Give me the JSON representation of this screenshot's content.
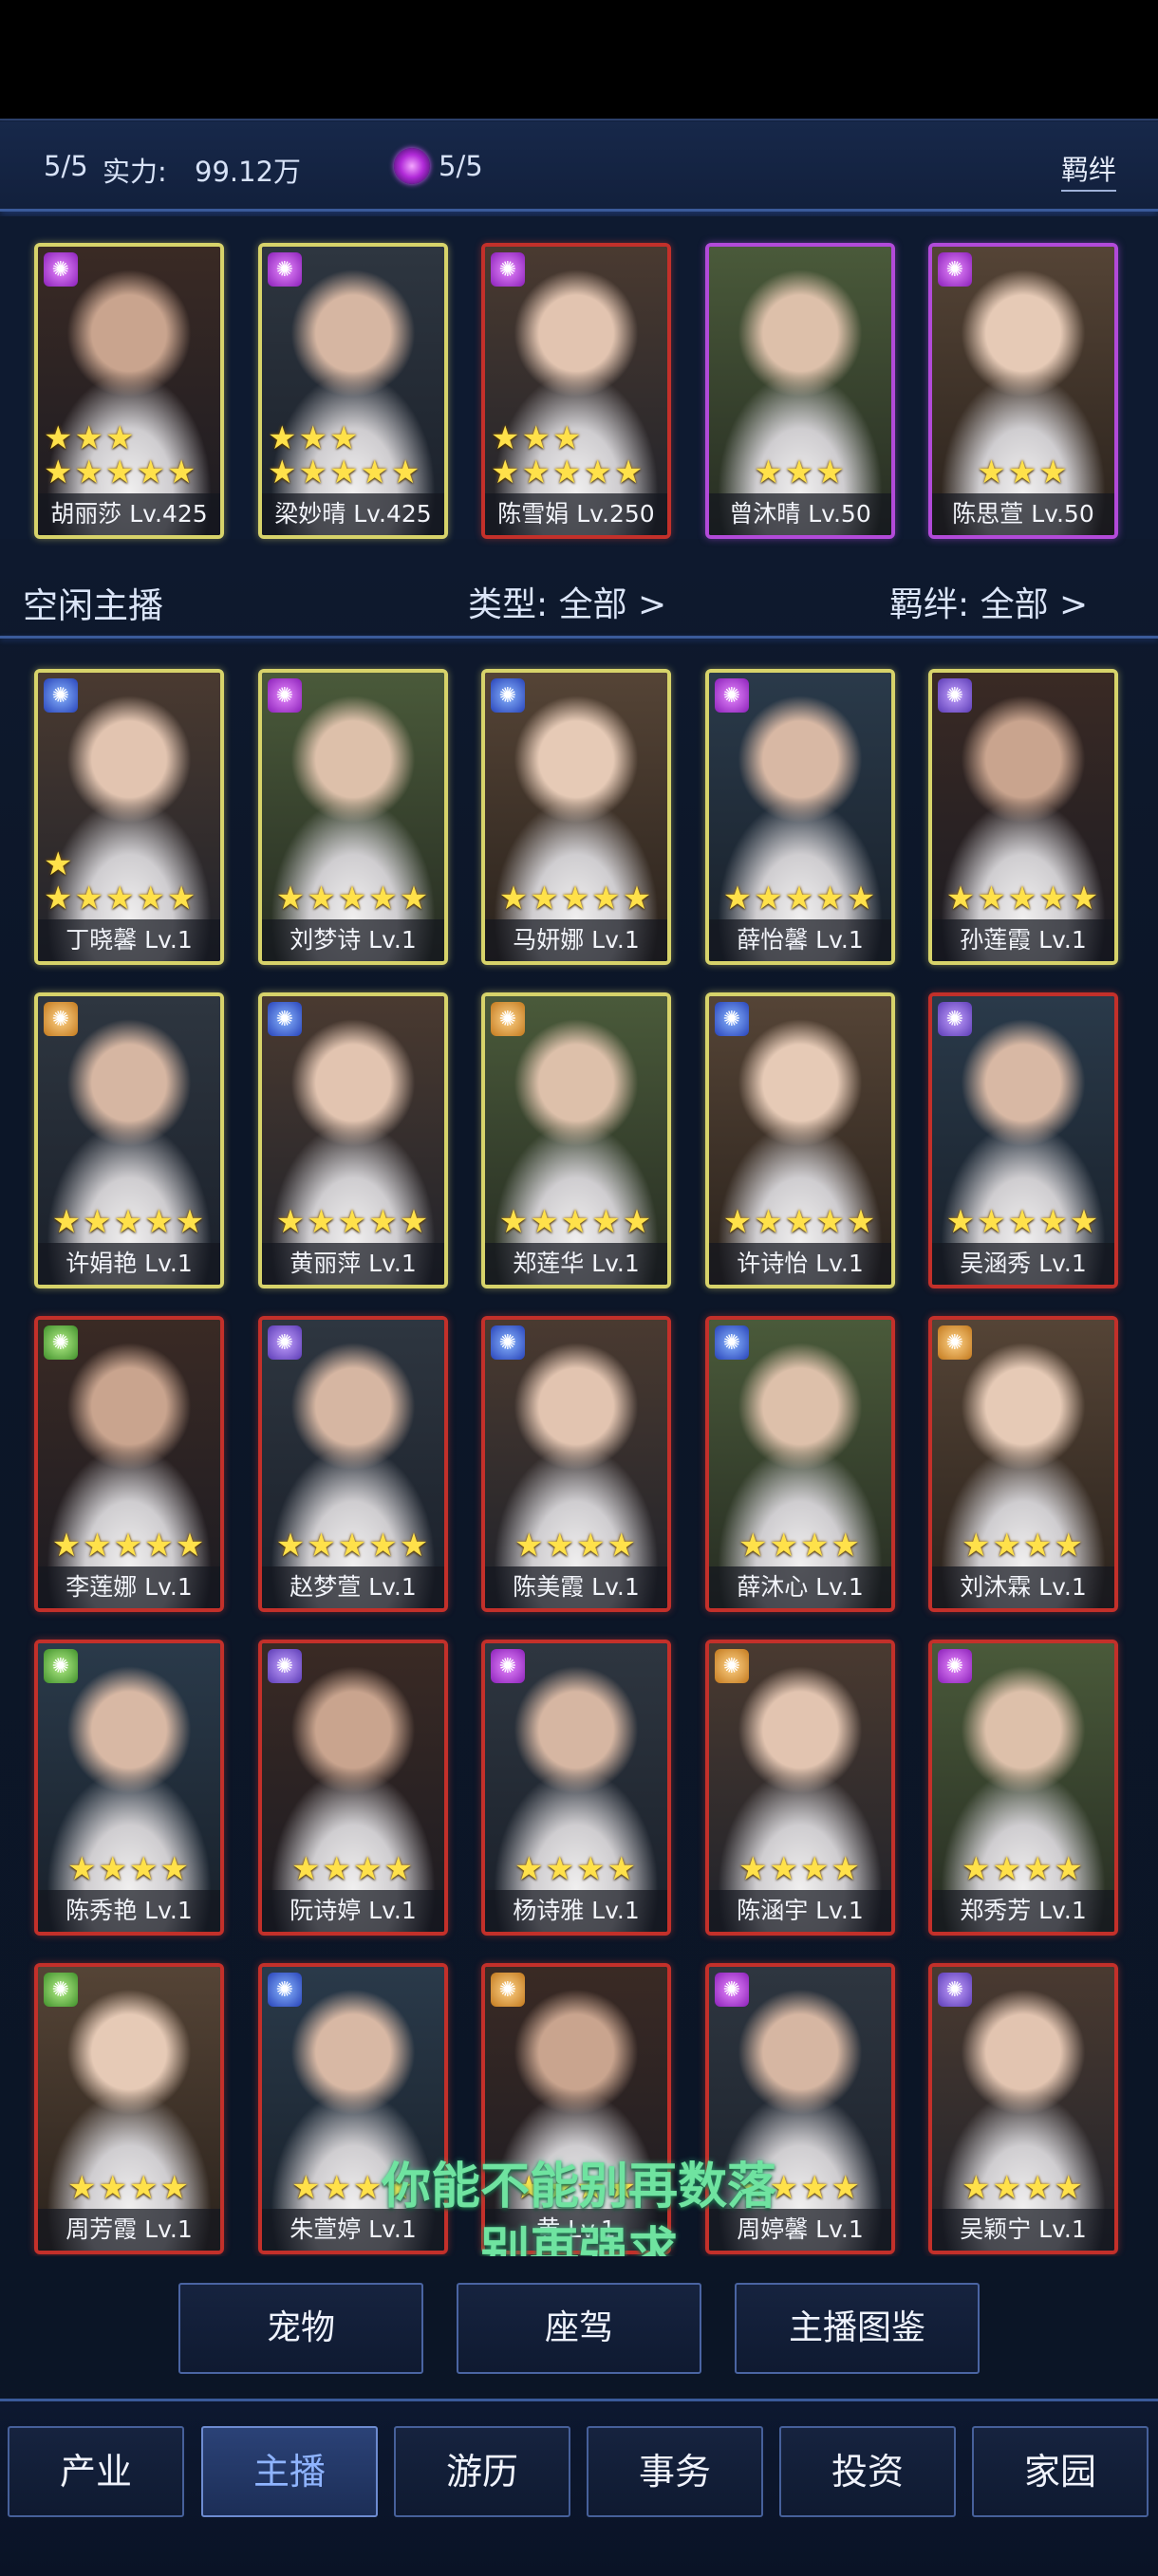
{
  "header": {
    "count": "5/5",
    "power_label": "实力:",
    "power_value": "99.12万",
    "gem_count": "5/5",
    "bond_button": "羁绊"
  },
  "team": [
    {
      "name": "胡丽莎",
      "level": "Lv.425",
      "stars": 8,
      "frame": "gold",
      "badge": "purple"
    },
    {
      "name": "梁妙晴",
      "level": "Lv.425",
      "stars": 8,
      "frame": "gold",
      "badge": "purple"
    },
    {
      "name": "陈雪娟",
      "level": "Lv.250",
      "stars": 8,
      "frame": "red",
      "badge": "purple"
    },
    {
      "name": "曾沐晴",
      "level": "Lv.50",
      "stars": 3,
      "frame": "purple",
      "badge": "none"
    },
    {
      "name": "陈思萱",
      "level": "Lv.50",
      "stars": 3,
      "frame": "purple",
      "badge": "purple"
    }
  ],
  "idle": {
    "title": "空闲主播",
    "type_filter": "类型: 全部 >",
    "bond_filter": "羁绊: 全部 >"
  },
  "hosts": [
    {
      "name": "丁晓馨",
      "level": "Lv.1",
      "stars": 6,
      "frame": "gold",
      "badge": "blue"
    },
    {
      "name": "刘梦诗",
      "level": "Lv.1",
      "stars": 5,
      "frame": "gold",
      "badge": "purple"
    },
    {
      "name": "马妍娜",
      "level": "Lv.1",
      "stars": 5,
      "frame": "gold",
      "badge": "blue"
    },
    {
      "name": "薛怡馨",
      "level": "Lv.1",
      "stars": 5,
      "frame": "gold",
      "badge": "purple"
    },
    {
      "name": "孙莲霞",
      "level": "Lv.1",
      "stars": 5,
      "frame": "gold",
      "badge": "violet"
    },
    {
      "name": "许娟艳",
      "level": "Lv.1",
      "stars": 5,
      "frame": "gold",
      "badge": "orange"
    },
    {
      "name": "黄丽萍",
      "level": "Lv.1",
      "stars": 5,
      "frame": "gold",
      "badge": "blue"
    },
    {
      "name": "郑莲华",
      "level": "Lv.1",
      "stars": 5,
      "frame": "gold",
      "badge": "orange"
    },
    {
      "name": "许诗怡",
      "level": "Lv.1",
      "stars": 5,
      "frame": "gold",
      "badge": "blue"
    },
    {
      "name": "吴涵秀",
      "level": "Lv.1",
      "stars": 5,
      "frame": "red",
      "badge": "violet"
    },
    {
      "name": "李莲娜",
      "level": "Lv.1",
      "stars": 5,
      "frame": "red",
      "badge": "green"
    },
    {
      "name": "赵梦萱",
      "level": "Lv.1",
      "stars": 5,
      "frame": "red",
      "badge": "violet"
    },
    {
      "name": "陈美霞",
      "level": "Lv.1",
      "stars": 4,
      "frame": "red",
      "badge": "blue"
    },
    {
      "name": "薛沐心",
      "level": "Lv.1",
      "stars": 4,
      "frame": "red",
      "badge": "blue"
    },
    {
      "name": "刘沐霖",
      "level": "Lv.1",
      "stars": 4,
      "frame": "red",
      "badge": "orange"
    },
    {
      "name": "陈秀艳",
      "level": "Lv.1",
      "stars": 4,
      "frame": "red",
      "badge": "green"
    },
    {
      "name": "阮诗婷",
      "level": "Lv.1",
      "stars": 4,
      "frame": "red",
      "badge": "violet"
    },
    {
      "name": "杨诗雅",
      "level": "Lv.1",
      "stars": 4,
      "frame": "red",
      "badge": "purple"
    },
    {
      "name": "陈涵宇",
      "level": "Lv.1",
      "stars": 4,
      "frame": "red",
      "badge": "orange"
    },
    {
      "name": "郑秀芳",
      "level": "Lv.1",
      "stars": 4,
      "frame": "red",
      "badge": "purple"
    },
    {
      "name": "周芳霞",
      "level": "Lv.1",
      "stars": 4,
      "frame": "red",
      "badge": "green"
    },
    {
      "name": "朱萱婷",
      "level": "Lv.1",
      "stars": 4,
      "frame": "red",
      "badge": "blue"
    },
    {
      "name": "黄",
      "level": "Lv.1",
      "stars": 4,
      "frame": "red",
      "badge": "orange"
    },
    {
      "name": "周婷馨",
      "level": "Lv.1",
      "stars": 4,
      "frame": "red",
      "badge": "purple"
    },
    {
      "name": "吴颖宁",
      "level": "Lv.1",
      "stars": 4,
      "frame": "red",
      "badge": "violet"
    }
  ],
  "overlay": {
    "line1": "你能不能别再数落",
    "line2": "别再强求"
  },
  "sub_buttons": [
    "宠物",
    "座驾",
    "主播图鉴"
  ],
  "nav": {
    "items": [
      "产业",
      "主播",
      "游历",
      "事务",
      "投资",
      "家园"
    ],
    "active_index": 1
  },
  "colors": {
    "frame_gold": "#d7d36a",
    "frame_purple": "#b24ad9",
    "frame_red": "#c3302a",
    "star": "#ffe14a",
    "nav_active": "#8fb4ff",
    "overlay_text": "#6fe3a0"
  }
}
